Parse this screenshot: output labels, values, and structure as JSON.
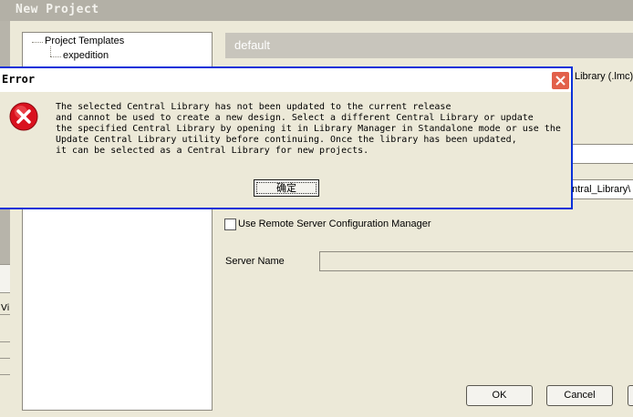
{
  "window": {
    "title": "New Project"
  },
  "left_strip": {
    "label": "Vi"
  },
  "tree": {
    "root_label": "Project Templates",
    "items": [
      {
        "label": "expedition"
      }
    ]
  },
  "template_header": {
    "name": "default"
  },
  "form": {
    "library_type_label": "Library (.lmc)",
    "central_library_value": "entral_Library\\",
    "remote_checkbox_label": "Use Remote Server Configuration Manager",
    "remote_checked": false,
    "server_name_label": "Server Name",
    "server_name_value": ""
  },
  "buttons": {
    "ok": "OK",
    "cancel": "Cancel"
  },
  "error_dialog": {
    "title": "Error",
    "message": "The selected Central Library has not been updated to the current release\nand cannot be used to create a new design. Select a different Central Library or update\nthe specified Central Library by opening it in Library Manager in Standalone mode or use the\nUpdate Central Library utility before continuing. Once the library has been updated,\nit can be selected as a Central Library for new projects.",
    "confirm_label": "确定",
    "icon": "error-icon",
    "close_icon": "close-icon"
  },
  "colors": {
    "dialog_border": "#0831d9",
    "close_button": "#e2604a",
    "error_icon": "#d9121f"
  }
}
